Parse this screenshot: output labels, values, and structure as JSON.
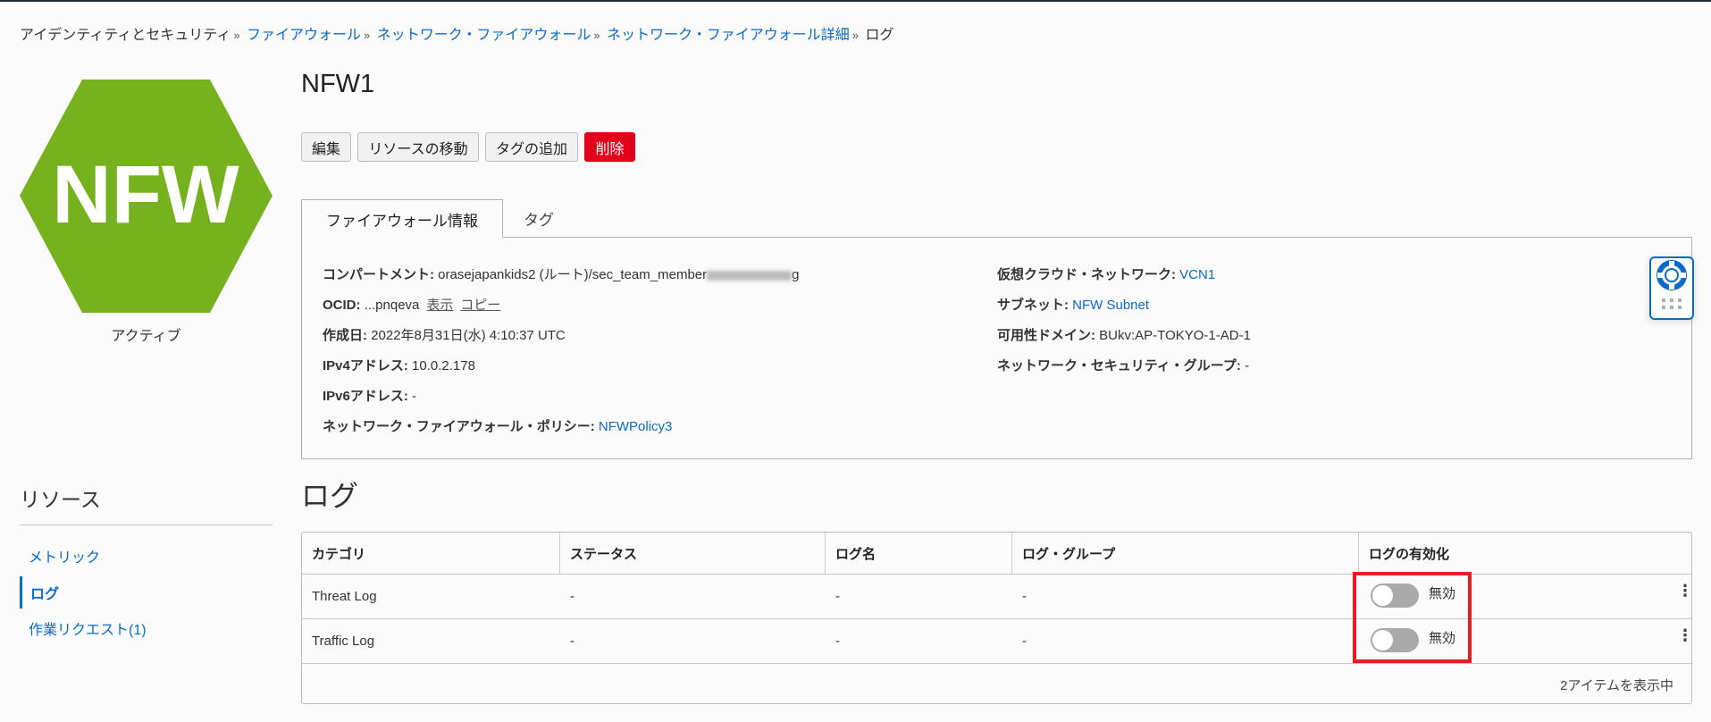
{
  "breadcrumb": {
    "items": [
      {
        "label": "アイデンティティとセキュリティ",
        "link": false
      },
      {
        "label": "ファイアウォール",
        "link": true
      },
      {
        "label": "ネットワーク・ファイアウォール",
        "link": true
      },
      {
        "label": "ネットワーク・ファイアウォール詳細",
        "link": true
      },
      {
        "label": "ログ",
        "link": false
      }
    ],
    "separator": "»"
  },
  "logo": {
    "text": "NFW",
    "color": "#76b21e"
  },
  "status": "アクティブ",
  "title": "NFW1",
  "actions": {
    "edit": "編集",
    "move": "リソースの移動",
    "add_tag": "タグの追加",
    "delete": "削除"
  },
  "tabs": [
    {
      "label": "ファイアウォール情報",
      "active": true
    },
    {
      "label": "タグ",
      "active": false
    }
  ],
  "info": {
    "compartment": {
      "label": "コンパートメント:",
      "value": "orasejapankids2 (ルート)/sec_team_member",
      "tail": "g"
    },
    "ocid": {
      "label": "OCID:",
      "value": "...pnqeva",
      "show": "表示",
      "copy": "コピー"
    },
    "created": {
      "label": "作成日:",
      "value": "2022年8月31日(水) 4:10:37 UTC"
    },
    "ipv4": {
      "label": "IPv4アドレス:",
      "value": "10.0.2.178"
    },
    "ipv6": {
      "label": "IPv6アドレス:",
      "value": "-"
    },
    "policy": {
      "label": "ネットワーク・ファイアウォール・ポリシー:",
      "value": "NFWPolicy3"
    },
    "vcn": {
      "label": "仮想クラウド・ネットワーク:",
      "value": "VCN1"
    },
    "subnet": {
      "label": "サブネット:",
      "value": "NFW Subnet"
    },
    "ad": {
      "label": "可用性ドメイン:",
      "value": "BUkv:AP-TOKYO-1-AD-1"
    },
    "nsg": {
      "label": "ネットワーク・セキュリティ・グループ:",
      "value": "-"
    }
  },
  "resources": {
    "title": "リソース",
    "items": [
      {
        "label": "メトリック",
        "active": false
      },
      {
        "label": "ログ",
        "active": true
      },
      {
        "label": "作業リクエスト(1)",
        "active": false
      }
    ]
  },
  "logs": {
    "heading": "ログ",
    "columns": [
      "カテゴリ",
      "ステータス",
      "ログ名",
      "ログ・グループ",
      "ログの有効化"
    ],
    "rows": [
      {
        "category": "Threat Log",
        "status": "-",
        "log_name": "-",
        "log_group": "-",
        "enabled": false,
        "toggle_label": "無効"
      },
      {
        "category": "Traffic Log",
        "status": "-",
        "log_name": "-",
        "log_group": "-",
        "enabled": false,
        "toggle_label": "無効"
      }
    ],
    "footer": "2アイテムを表示中"
  },
  "colors": {
    "link": "#0b6bc6",
    "danger": "#e3001b",
    "highlight": "#ed1c24"
  }
}
